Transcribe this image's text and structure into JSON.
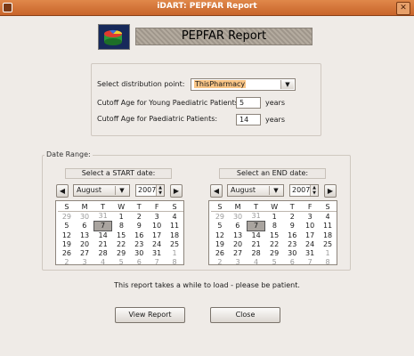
{
  "window": {
    "title": "iDART: PEPFAR Report",
    "close_label": "✕"
  },
  "header": {
    "title": "PEPFAR Report"
  },
  "form": {
    "dist_label": "Select distribution point:",
    "dist_value": "ThisPharmacy",
    "young_label": "Cutoff Age for Young Paediatric Patients:",
    "young_value": "5",
    "paed_label": "Cutoff Age for Paediatric Patients:",
    "paed_value": "14",
    "years_unit": "years"
  },
  "date_range": {
    "legend": "Date Range:",
    "start": {
      "caption": "Select a START date:",
      "month": "August",
      "year": "2007",
      "selected_day": "7"
    },
    "end": {
      "caption": "Select an END date:",
      "month": "August",
      "year": "2007",
      "selected_day": "7"
    },
    "weekdays": [
      "S",
      "M",
      "T",
      "W",
      "T",
      "F",
      "S"
    ],
    "weeks": [
      [
        "29",
        "30",
        "31",
        "1",
        "2",
        "3",
        "4"
      ],
      [
        "5",
        "6",
        "7",
        "8",
        "9",
        "10",
        "11"
      ],
      [
        "12",
        "13",
        "14",
        "15",
        "16",
        "17",
        "18"
      ],
      [
        "19",
        "20",
        "21",
        "22",
        "23",
        "24",
        "25"
      ],
      [
        "26",
        "27",
        "28",
        "29",
        "30",
        "31",
        "1"
      ],
      [
        "2",
        "3",
        "4",
        "5",
        "6",
        "7",
        "8"
      ]
    ]
  },
  "note": "This report takes a while to load - please be patient.",
  "buttons": {
    "view": "View Report",
    "close": "Close"
  },
  "icons": {
    "prev": "◀",
    "next": "▶",
    "dropdown": "▼",
    "spin_up": "▲",
    "spin_down": "▼"
  },
  "colors": {
    "titlebar": "#d0723a",
    "highlight": "#f9c586",
    "selected_day": "#a9a49f"
  }
}
